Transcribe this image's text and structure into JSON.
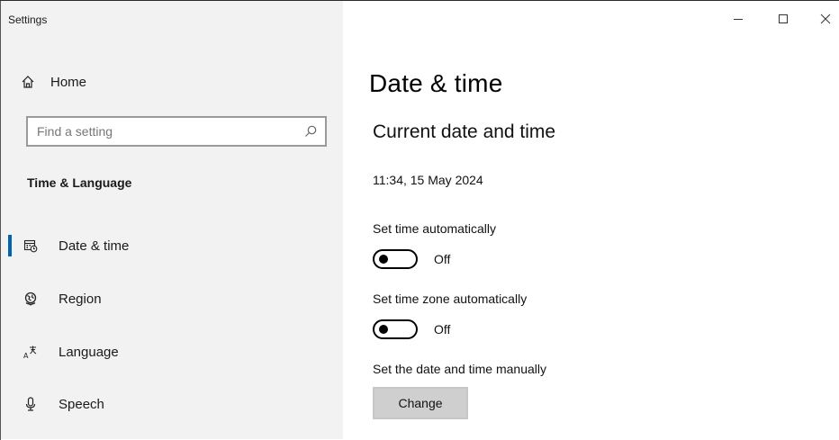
{
  "window": {
    "title": "Settings",
    "controls": [
      "minimize-icon",
      "maximize-icon",
      "close-icon"
    ]
  },
  "sidebar": {
    "home_label": "Home",
    "search": {
      "placeholder": "Find a setting",
      "value": ""
    },
    "section_title": "Time & Language",
    "items": [
      {
        "label": "Date & time",
        "icon": "calendar-clock-icon",
        "active": true
      },
      {
        "label": "Region",
        "icon": "globe-icon",
        "active": false
      },
      {
        "label": "Language",
        "icon": "language-icon",
        "active": false
      },
      {
        "label": "Speech",
        "icon": "microphone-icon",
        "active": false
      }
    ]
  },
  "main": {
    "title": "Date & time",
    "subtitle": "Current date and time",
    "current_datetime": "11:34, 15 May 2024",
    "set_time_auto": {
      "label": "Set time automatically",
      "state": "Off"
    },
    "set_timezone_auto": {
      "label": "Set time zone automatically",
      "state": "Off"
    },
    "manual": {
      "label": "Set the date and time manually",
      "button": "Change"
    }
  },
  "colors": {
    "accent": "#0063b1",
    "sidebar_bg": "#f2f2f2",
    "button_bg": "#cfcfcf"
  }
}
